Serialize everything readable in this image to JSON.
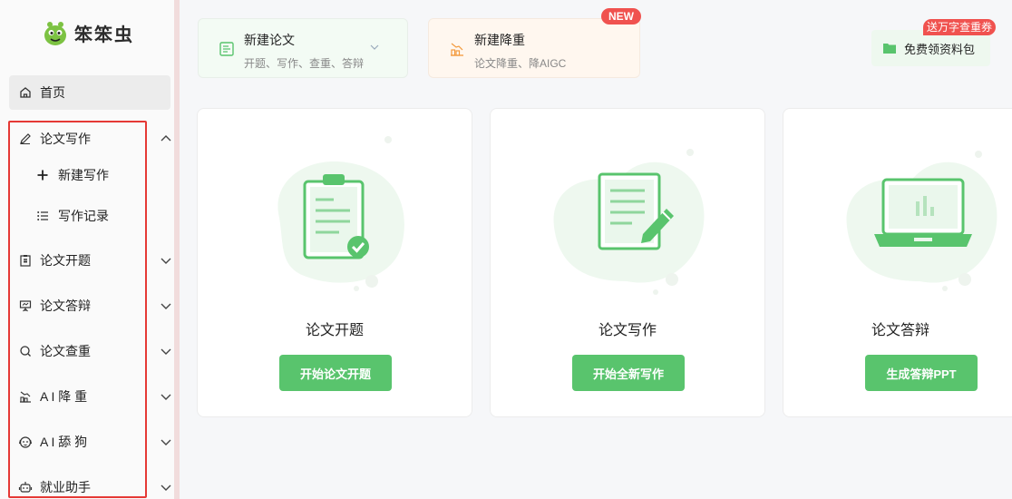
{
  "brand": {
    "name": "笨笨虫"
  },
  "sidebar": {
    "home": "首页",
    "paper_writing": "论文写作",
    "new_writing": "新建写作",
    "writing_records": "写作记录",
    "proposal": "论文开题",
    "defense": "论文答辩",
    "plagiarism_check": "论文查重",
    "ai_reduce": "A I 降 重",
    "ai_lick": "A I 舔 狗",
    "job_assistant": "就业助手"
  },
  "top_cards": [
    {
      "title": "新建论文",
      "subtitle": "开题、写作、查重、答辩",
      "icon": "document-icon"
    },
    {
      "title": "新建降重",
      "subtitle": "论文降重、降AIGC",
      "icon": "chart-icon",
      "badge": "NEW"
    }
  ],
  "free_pack": {
    "label": "免费领资料包",
    "badge": "送万字查重券"
  },
  "features": [
    {
      "title": "论文开题",
      "button": "开始论文开题"
    },
    {
      "title": "论文写作",
      "button": "开始全新写作"
    },
    {
      "title": "论文答辩",
      "button": "生成答辩PPT"
    }
  ],
  "colors": {
    "accent": "#59c46d",
    "badge": "#f0524f",
    "highlight_border": "#e53935"
  }
}
